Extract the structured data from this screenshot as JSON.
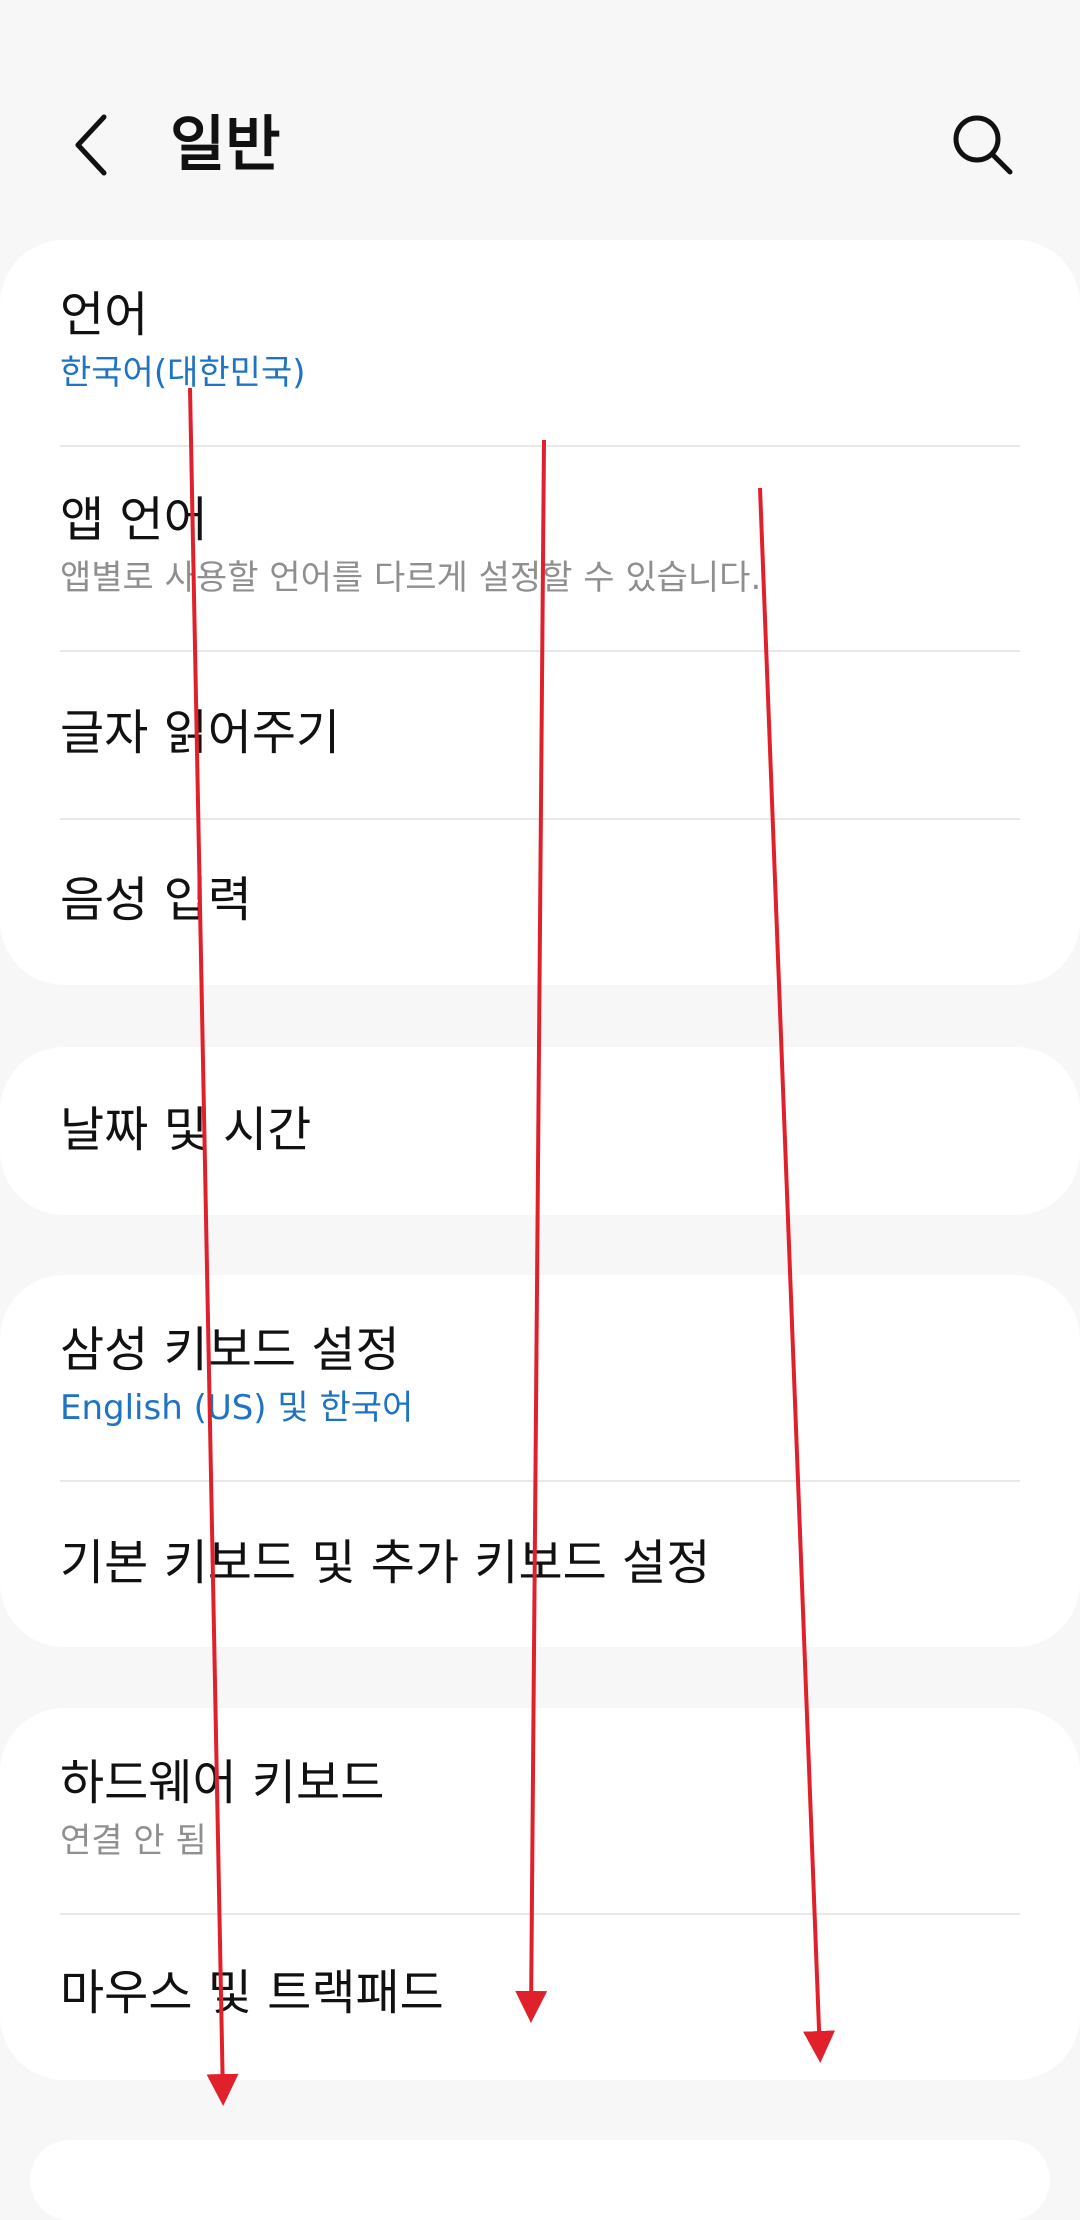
{
  "header": {
    "title": "일반",
    "back_icon": "chevron-left-icon",
    "search_icon": "search-icon"
  },
  "sections": [
    {
      "items": [
        {
          "title": "언어",
          "subtitle": "한국어(대한민국)",
          "subtitle_style": "blue"
        },
        {
          "title": "앱 언어",
          "subtitle": "앱별로 사용할 언어를 다르게 설정할 수 있습니다.",
          "subtitle_style": "gray"
        },
        {
          "title": "글자 읽어주기"
        },
        {
          "title": "음성 입력"
        }
      ]
    },
    {
      "items": [
        {
          "title": "날짜 및 시간"
        }
      ]
    },
    {
      "items": [
        {
          "title": "삼성 키보드 설정",
          "subtitle": "English (US) 및 한국어",
          "subtitle_style": "blue"
        },
        {
          "title": "기본 키보드 및 추가 키보드 설정"
        }
      ]
    },
    {
      "items": [
        {
          "title": "하드웨어 키보드",
          "subtitle": "연결 안 됨",
          "subtitle_style": "gray"
        },
        {
          "title": "마우스 및 트랙패드"
        }
      ]
    }
  ],
  "colors": {
    "background": "#f7f7f7",
    "card": "#ffffff",
    "accent_blue": "#1f73c4",
    "subtitle_gray": "#8f8f8f",
    "annotation_red": "#e0212b"
  }
}
